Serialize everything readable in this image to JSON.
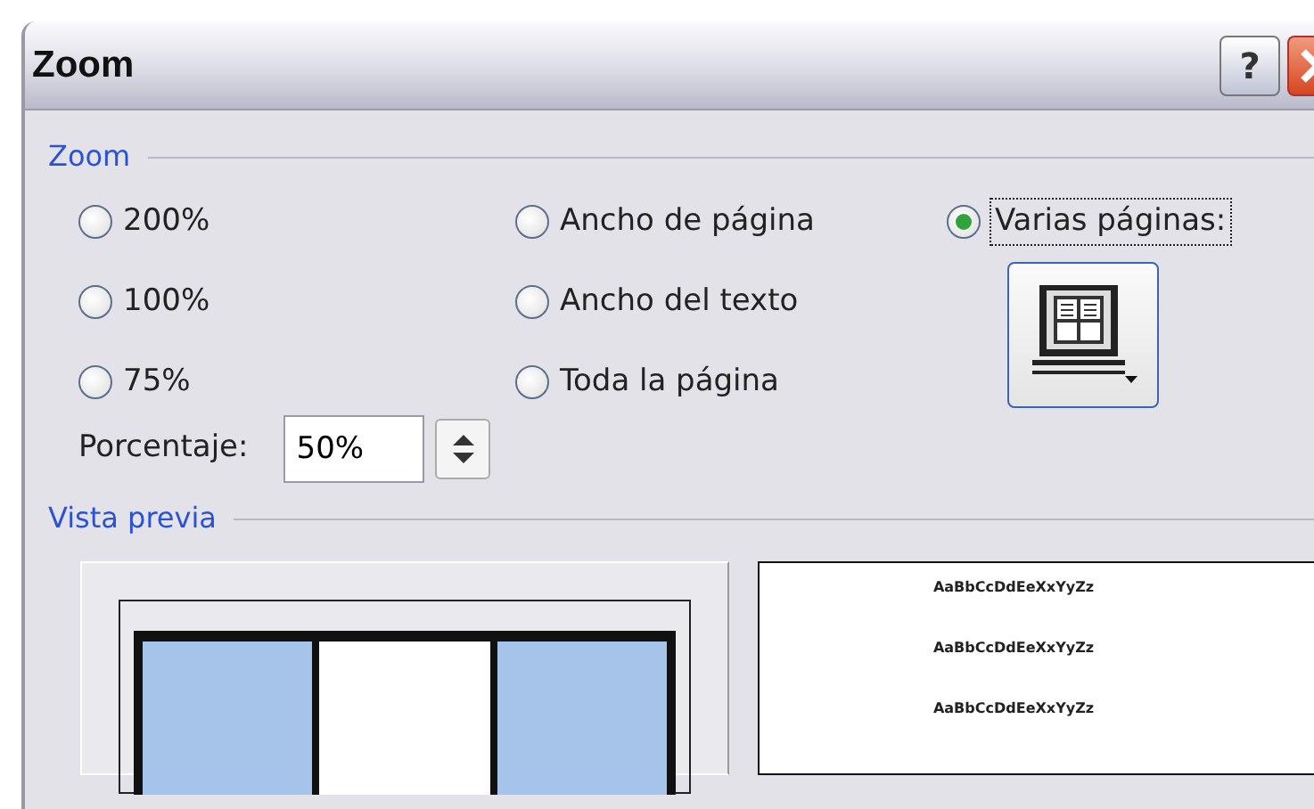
{
  "window": {
    "title": "Zoom",
    "help_button": "?"
  },
  "zoom_group": {
    "label": "Zoom",
    "columns": [
      [
        {
          "label": "200%",
          "selected": false
        },
        {
          "label": "100%",
          "selected": false
        },
        {
          "label": "75%",
          "selected": false
        }
      ],
      [
        {
          "label": "Ancho de página",
          "selected": false
        },
        {
          "label": "Ancho del texto",
          "selected": false
        },
        {
          "label": "Toda la página",
          "selected": false
        }
      ],
      [
        {
          "label": "Varias páginas:",
          "selected": true
        }
      ]
    ],
    "percent": {
      "label": "Porcentaje:",
      "value": "50%"
    }
  },
  "preview_group": {
    "label": "Vista previa",
    "sample_lines": [
      "AaBbCcDdEeXxYyZz",
      "AaBbCcDdEeXxYyZz",
      "AaBbCcDdEeXxYyZz"
    ]
  }
}
